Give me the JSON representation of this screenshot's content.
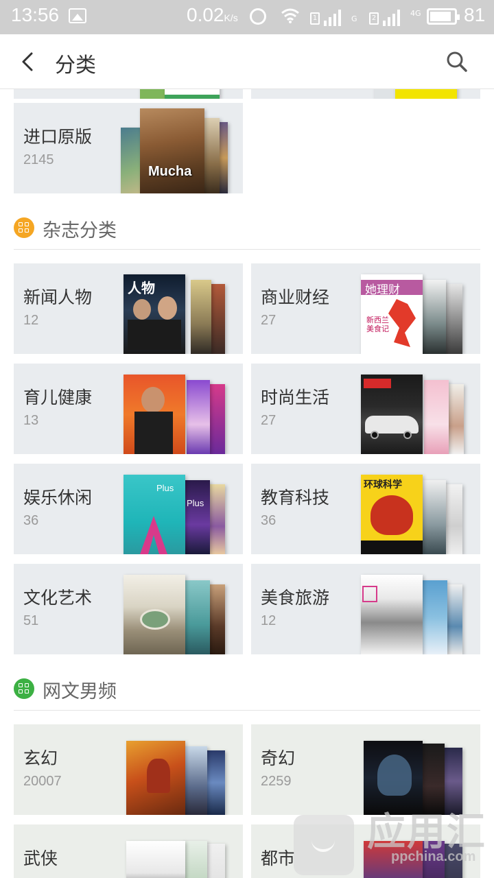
{
  "status_bar": {
    "time": "13:56",
    "speed": "0.02",
    "speed_unit": "K/s",
    "sim1": "1",
    "sim2": "2",
    "net1": "G",
    "net2": "4G",
    "battery_level": "81"
  },
  "header": {
    "title": "分类"
  },
  "top_card": {
    "name": "进口原版",
    "count": "2145"
  },
  "magazine_section": {
    "title": "杂志分类",
    "badge_color": "#f5a623",
    "items": [
      {
        "name": "新闻人物",
        "count": "12"
      },
      {
        "name": "商业财经",
        "count": "27"
      },
      {
        "name": "育儿健康",
        "count": "13"
      },
      {
        "name": "时尚生活",
        "count": "27"
      },
      {
        "name": "娱乐休闲",
        "count": "36"
      },
      {
        "name": "教育科技",
        "count": "36"
      },
      {
        "name": "文化艺术",
        "count": "51"
      },
      {
        "name": "美食旅游",
        "count": "12"
      }
    ]
  },
  "novel_section": {
    "title": "网文男频",
    "badge_color": "#3cb043",
    "items": [
      {
        "name": "玄幻",
        "count": "20007"
      },
      {
        "name": "奇幻",
        "count": "2259"
      },
      {
        "name": "武侠",
        "count": ""
      },
      {
        "name": "都市",
        "count": ""
      }
    ]
  },
  "covers": {
    "mucha_title": "Mucha",
    "renwu_title": "人物",
    "licai_title": "她理财",
    "licai_sub": "新西兰美食记",
    "huanqiu_title": "环球科学",
    "plus_title": "Plus"
  },
  "watermark": {
    "text": "应用汇",
    "sub": "ppchina.com"
  }
}
